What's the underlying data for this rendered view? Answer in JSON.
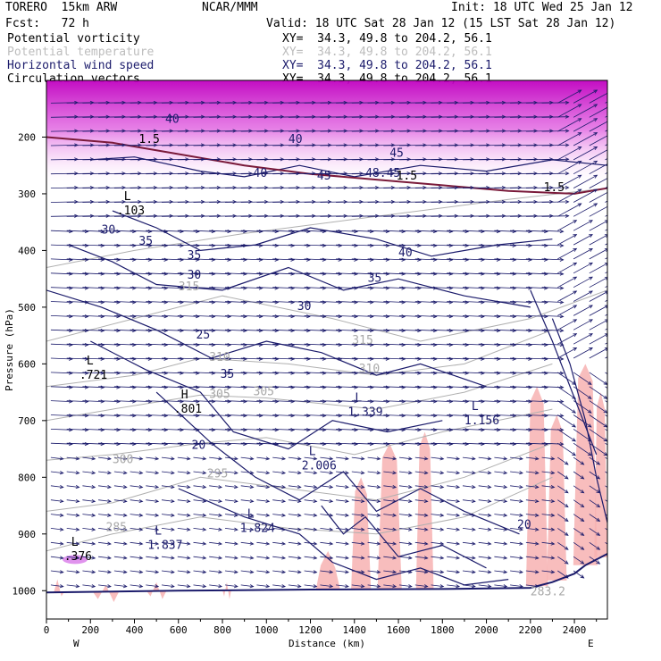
{
  "header": {
    "model": "TORERO  15km ARW",
    "org": "NCAR/MMM",
    "init": "Init: 18 UTC Wed 25 Jan 12",
    "fcst": "Fcst:   72 h",
    "valid": "Valid: 18 UTC Sat 28 Jan 12 (15 LST Sat 28 Jan 12)"
  },
  "legend": [
    {
      "name": "Potential vorticity",
      "xy": "XY=  34.3, 49.8 to 204.2, 56.1",
      "color": "#000000"
    },
    {
      "name": "Potential temperature",
      "xy": "XY=  34.3, 49.8 to 204.2, 56.1",
      "color": "#bbbbbb"
    },
    {
      "name": "Horizontal wind speed",
      "xy": "XY=  34.3, 49.8 to 204.2, 56.1",
      "color": "#1b1b6b"
    },
    {
      "name": "Circulation vectors",
      "xy": "XY=  34.3, 49.8 to 204.2, 56.1",
      "color": "#000000"
    }
  ],
  "colors": {
    "wind_contour": "#1b1b6b",
    "theta_contour": "#b0b0b0",
    "pv_contour": "#7a1a3a",
    "pv_fill_low": "#f7b2b2",
    "pv_fill_high": "#e040e0",
    "vectors": "#1b1b6b"
  },
  "chart_data": {
    "type": "cross-section",
    "xlabel": "Distance (km)",
    "ylabel": "Pressure (hPa)",
    "xlim": [
      0,
      2550
    ],
    "ylim": [
      1050,
      100
    ],
    "x_ticks": [
      "0",
      "200",
      "400",
      "600",
      "800",
      "1000",
      "1200",
      "1400",
      "1600",
      "1800",
      "2000",
      "2200",
      "2400"
    ],
    "y_ticks": [
      "200",
      "300",
      "400",
      "500",
      "600",
      "700",
      "800",
      "900",
      "1000"
    ],
    "x_end_labels": {
      "left": "W",
      "right": "E"
    },
    "wind_speed_labels": [
      {
        "x": 540,
        "p": 175,
        "text": "40"
      },
      {
        "x": 1100,
        "p": 210,
        "text": "40"
      },
      {
        "x": 1560,
        "p": 235,
        "text": "45"
      },
      {
        "x": 940,
        "p": 270,
        "text": "40"
      },
      {
        "x": 1230,
        "p": 275,
        "text": "45"
      },
      {
        "x": 1450,
        "p": 270,
        "text": "48.45"
      },
      {
        "x": 420,
        "p": 390,
        "text": "35"
      },
      {
        "x": 640,
        "p": 415,
        "text": "35"
      },
      {
        "x": 1600,
        "p": 410,
        "text": "40"
      },
      {
        "x": 640,
        "p": 450,
        "text": "30"
      },
      {
        "x": 1460,
        "p": 455,
        "text": "35"
      },
      {
        "x": 1140,
        "p": 505,
        "text": "30"
      },
      {
        "x": 680,
        "p": 555,
        "text": "25"
      },
      {
        "x": 790,
        "p": 625,
        "text": "35"
      },
      {
        "x": 250,
        "p": 370,
        "text": "30"
      },
      {
        "x": 660,
        "p": 750,
        "text": "20"
      },
      {
        "x": 2140,
        "p": 890,
        "text": "20"
      }
    ],
    "theta_labels": [
      {
        "x": 600,
        "p": 470,
        "text": "315"
      },
      {
        "x": 1390,
        "p": 565,
        "text": "315"
      },
      {
        "x": 740,
        "p": 595,
        "text": "310"
      },
      {
        "x": 1420,
        "p": 615,
        "text": "310"
      },
      {
        "x": 740,
        "p": 660,
        "text": "305"
      },
      {
        "x": 940,
        "p": 655,
        "text": "305"
      },
      {
        "x": 300,
        "p": 775,
        "text": "300"
      },
      {
        "x": 730,
        "p": 800,
        "text": "295"
      },
      {
        "x": 270,
        "p": 895,
        "text": "285"
      },
      {
        "x": 2200,
        "p": 1008,
        "text": "283.2"
      }
    ],
    "pv_labels": [
      {
        "x": 420,
        "p": 210,
        "text": "1.5"
      },
      {
        "x": 1590,
        "p": 275,
        "text": "1.5"
      },
      {
        "x": 2260,
        "p": 295,
        "text": "1.5"
      }
    ],
    "extrema": [
      {
        "kind": "L",
        "x": 320,
        "p": 330,
        "value": ".103",
        "color": "#000000"
      },
      {
        "kind": "L",
        "x": 150,
        "p": 620,
        "value": ".721",
        "color": "#000000"
      },
      {
        "kind": "H",
        "x": 580,
        "p": 680,
        "value": ".801",
        "color": "#000000"
      },
      {
        "kind": "L",
        "x": 1370,
        "p": 685,
        "value": "1.339",
        "color": "#1b1b6b"
      },
      {
        "kind": "L",
        "x": 1900,
        "p": 700,
        "value": "1.156",
        "color": "#1b1b6b"
      },
      {
        "kind": "L",
        "x": 1160,
        "p": 780,
        "value": "2.006",
        "color": "#1b1b6b"
      },
      {
        "kind": "L",
        "x": 880,
        "p": 890,
        "value": "1.824",
        "color": "#1b1b6b"
      },
      {
        "kind": "L",
        "x": 460,
        "p": 920,
        "value": "1.837",
        "color": "#1b1b6b"
      },
      {
        "kind": "L",
        "x": 80,
        "p": 940,
        "value": ".376",
        "color": "#000000"
      }
    ]
  }
}
